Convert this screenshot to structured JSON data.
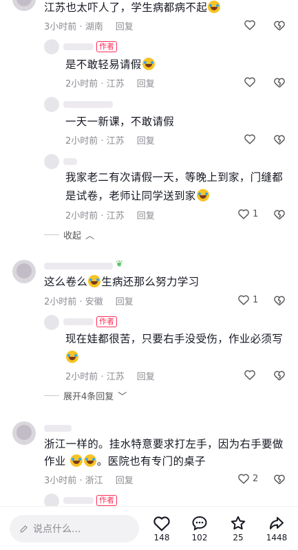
{
  "comments": [
    {
      "text": "江苏也太吓人了，学生病都病不起",
      "emoji_after": true,
      "time": "3小时前",
      "location": "湖南",
      "reply": "回复",
      "likes": ""
    },
    {
      "author_badge": "作者",
      "text": "是不敢轻易请假",
      "time": "2小时前",
      "location": "江苏",
      "reply": "回复"
    },
    {
      "text": "一天一新课，不敢请假",
      "time": "2小时前",
      "location": "江苏",
      "reply": "回复"
    },
    {
      "text_line1": "我家老二有次请假一天，等晚上到家，门缝都",
      "text_line2": "是试卷，老师让同学送到家",
      "time": "2小时前",
      "location": "江苏",
      "reply": "回复",
      "likes": "1"
    },
    {
      "text_part1": "这么卷么",
      "text_part2": "生病还那么努力学习",
      "time": "2小时前",
      "location": "安徽",
      "reply": "回复",
      "likes": "1"
    },
    {
      "author_badge": "作者",
      "text_line1": "现在娃都很苦，只要右手没受伤，作业必须写",
      "time": "2小时前",
      "location": "江苏",
      "reply": "回复"
    },
    {
      "text_line1": "浙江一样的。挂水特意要求打左手，因为右手要做",
      "text_line2_part1": "作业",
      "text_line2_part2": "。医院也有专门的桌子",
      "time": "3小时前",
      "location": "浙江",
      "reply": "回复",
      "likes": "2"
    },
    {
      "author_badge": "作者"
    }
  ],
  "collapse_label": "收起",
  "expand_label": "展开4条回复",
  "bottom_bar": {
    "input_placeholder": "说点什么...",
    "likes": "148",
    "comments": "102",
    "favorites": "25",
    "shares": "1448"
  },
  "colors": {
    "accent": "#fe2c55",
    "meta_gray": "#8a8b91"
  }
}
